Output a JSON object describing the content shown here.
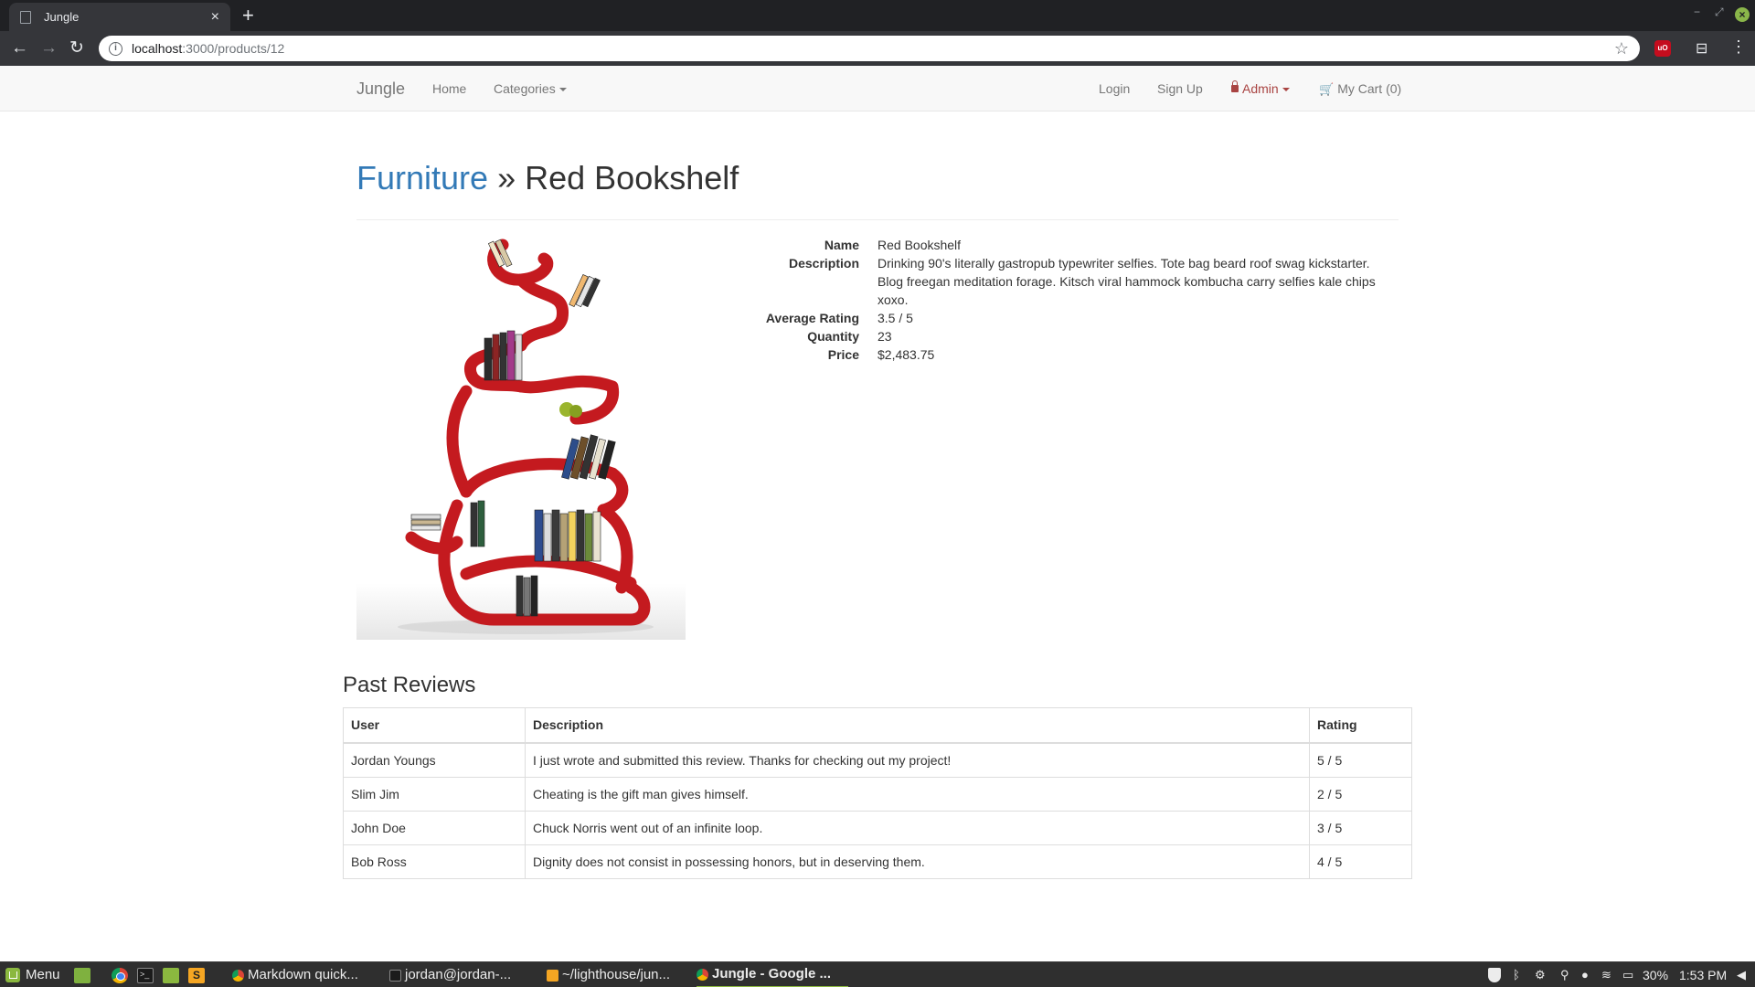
{
  "browser": {
    "tab_title": "Jungle",
    "tab_close": "×",
    "new_tab": "+",
    "url_host": "localhost",
    "url_path": ":3000/products/12",
    "icons": [
      "page-icon",
      "close-icon",
      "plus-icon",
      "back-icon",
      "forward-icon",
      "reload-icon",
      "info-icon",
      "star-icon",
      "ublock-icon",
      "incognito-icon",
      "kebab-menu-icon"
    ]
  },
  "navbar": {
    "brand": "Jungle",
    "home": "Home",
    "categories": "Categories",
    "login": "Login",
    "signup": "Sign Up",
    "admin": "Admin",
    "cart": "My Cart (0)",
    "admin_color": "#a94442"
  },
  "product": {
    "category": "Furniture",
    "separator": "»",
    "name_title": "Red Bookshelf",
    "specs": {
      "name_label": "Name",
      "name_value": "Red Bookshelf",
      "description_label": "Description",
      "description_value": "Drinking 90's literally gastropub typewriter selfies. Tote bag beard roof swag kickstarter. Blog freegan meditation forage. Kitsch viral hammock kombucha carry selfies kale chips xoxo.",
      "rating_label": "Average Rating",
      "rating_value": "3.5 / 5",
      "quantity_label": "Quantity",
      "quantity_value": "23",
      "price_label": "Price",
      "price_value": "$2,483.75"
    },
    "link_color": "#337ab7",
    "shelf_color": "#c41a1f"
  },
  "reviews": {
    "title": "Past Reviews",
    "headers": {
      "user": "User",
      "description": "Description",
      "rating": "Rating"
    },
    "rows": [
      {
        "user": "Jordan Youngs",
        "description": "I just wrote and submitted this review. Thanks for checking out my project!",
        "rating": "5 / 5"
      },
      {
        "user": "Slim Jim",
        "description": "Cheating is the gift man gives himself.",
        "rating": "2 / 5"
      },
      {
        "user": "John Doe",
        "description": "Chuck Norris went out of an infinite loop.",
        "rating": "3 / 5"
      },
      {
        "user": "Bob Ross",
        "description": "Dignity does not consist in possessing honors, but in deserving them.",
        "rating": "4 / 5"
      }
    ]
  },
  "taskbar": {
    "menu_label": "Menu",
    "tasks": [
      "Markdown quick...",
      "jordan@jordan-...",
      "~/lighthouse/jun...",
      "Jungle - Google ..."
    ],
    "battery": "30%",
    "clock": "1:53 PM",
    "sublime_glyph": "S"
  }
}
